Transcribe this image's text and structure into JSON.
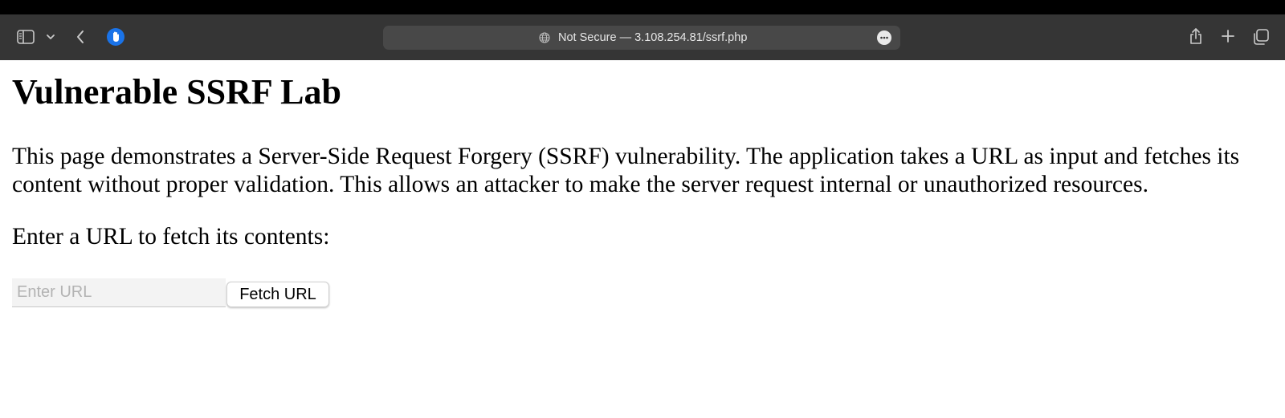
{
  "browser": {
    "address_bar": {
      "security_label": "Not Secure",
      "separator": " — ",
      "url": "3.108.254.81/ssrf.php"
    },
    "icons": {
      "sidebar": "sidebar-icon",
      "chevron": "chevron-down-icon",
      "back": "back-arrow-icon",
      "extension": "privacy-shield-icon",
      "globe": "globe-icon",
      "more": "more-options-icon",
      "share": "share-icon",
      "new_tab": "plus-icon",
      "tabs": "tab-overview-icon"
    },
    "colors": {
      "toolbar": "#353535",
      "address_bar": "#484848",
      "extension_accent": "#1a73e8"
    }
  },
  "page": {
    "title": "Vulnerable SSRF Lab",
    "description": "This page demonstrates a Server-Side Request Forgery (SSRF) vulnerability. The application takes a URL as input and fetches its content without proper validation. This allows an attacker to make the server request internal or unauthorized resources.",
    "prompt": "Enter a URL to fetch its contents:",
    "form": {
      "url_input": {
        "value": "",
        "placeholder": "Enter URL"
      },
      "submit_label": "Fetch URL"
    }
  }
}
